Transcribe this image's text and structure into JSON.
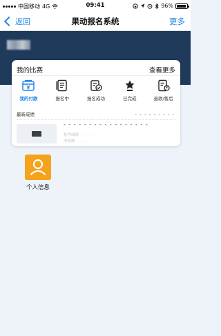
{
  "status_bar": {
    "carrier": "中国移动",
    "network": "4G",
    "time": "09:41",
    "battery_percent": "96%",
    "battery_level": 0.96
  },
  "nav": {
    "back_label": "返回",
    "title": "果动报名系统",
    "more_label": "更多"
  },
  "competition_card": {
    "title": "我的比赛",
    "more_label": "查看更多",
    "items": [
      {
        "label": "我的付款",
        "icon": "wallet-icon",
        "active": true
      },
      {
        "label": "报名中",
        "icon": "document-list-icon",
        "active": false
      },
      {
        "label": "报名成功",
        "icon": "document-check-icon",
        "active": false
      },
      {
        "label": "已完成",
        "icon": "trophy-icon",
        "active": false
      },
      {
        "label": "退款/售后",
        "icon": "refund-icon",
        "active": false
      }
    ],
    "score_title": "最新成绩",
    "score_placeholder": "- - - - - - - - -",
    "score_main": "- - - - - - - - - - - - - - - - -",
    "score_line_1": "枪声成绩 - - - - - -",
    "score_line_2": "净成绩 - - - - - -"
  },
  "apps": [
    {
      "label": "个人信息",
      "icon": "person-icon",
      "color": "#f5a21c"
    }
  ],
  "colors": {
    "accent": "#1f86e8",
    "hero": "#1f3a5a",
    "tile": "#f5a21c"
  }
}
